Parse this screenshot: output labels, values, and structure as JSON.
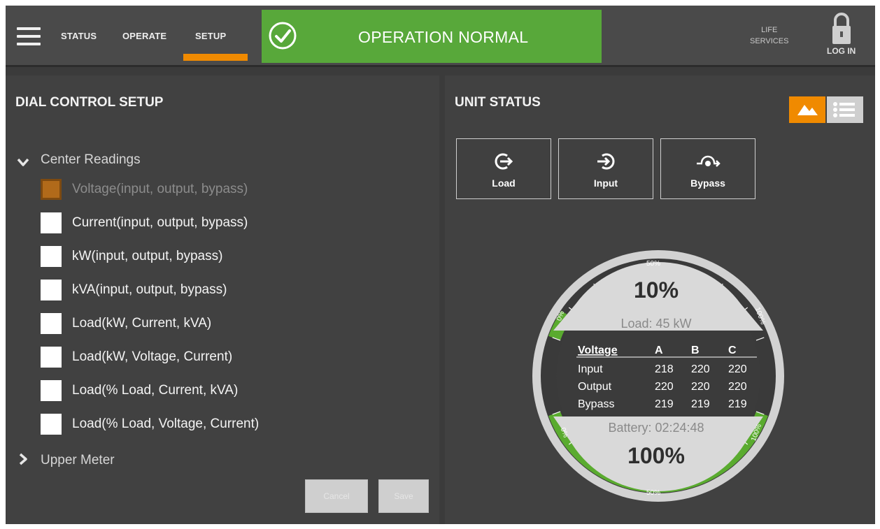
{
  "header": {
    "nav": [
      "STATUS",
      "OPERATE",
      "SETUP"
    ],
    "active_nav": "SETUP",
    "status_banner": "OPERATION NORMAL",
    "life_services_line1": "LIFE",
    "life_services_line2": "SERVICES",
    "login": "LOG IN"
  },
  "left": {
    "title": "DIAL CONTROL SETUP",
    "center_readings": "Center Readings",
    "options": [
      {
        "label": "Voltage(input, output, bypass)",
        "checked": true,
        "disabled": true
      },
      {
        "label": "Current(input, output, bypass)",
        "checked": false
      },
      {
        "label": "kW(input, output, bypass)",
        "checked": false
      },
      {
        "label": "kVA(input, output, bypass)",
        "checked": false
      },
      {
        "label": "Load(kW, Current, kVA)",
        "checked": false
      },
      {
        "label": "Load(kW, Voltage, Current)",
        "checked": false
      },
      {
        "label": "Load(% Load, Current, kVA)",
        "checked": false
      },
      {
        "label": "Load(% Load, Voltage, Current)",
        "checked": false
      }
    ],
    "upper_meter": "Upper Meter",
    "cancel": "Cancel",
    "save": "Save"
  },
  "right": {
    "title": "UNIT STATUS",
    "buttons": [
      "Load",
      "Input",
      "Bypass"
    ],
    "dial": {
      "load_percent": "10%",
      "load_kw": "Load: 45 kW",
      "table_headers": [
        "Voltage",
        "A",
        "B",
        "C"
      ],
      "table_rows": [
        [
          "Input",
          "218",
          "220",
          "220"
        ],
        [
          "Output",
          "220",
          "220",
          "220"
        ],
        [
          "Bypass",
          "219",
          "219",
          "219"
        ]
      ],
      "battery_time": "Battery: 02:24:48",
      "battery_percent": "100%",
      "scale_0": "0%",
      "scale_50": "50%",
      "scale_100": "100%",
      "load_level": 0.1,
      "battery_level": 1.0
    }
  },
  "colors": {
    "accent": "#f08a00",
    "ok": "#58a83a",
    "gauge_green": "#5aab2f"
  }
}
